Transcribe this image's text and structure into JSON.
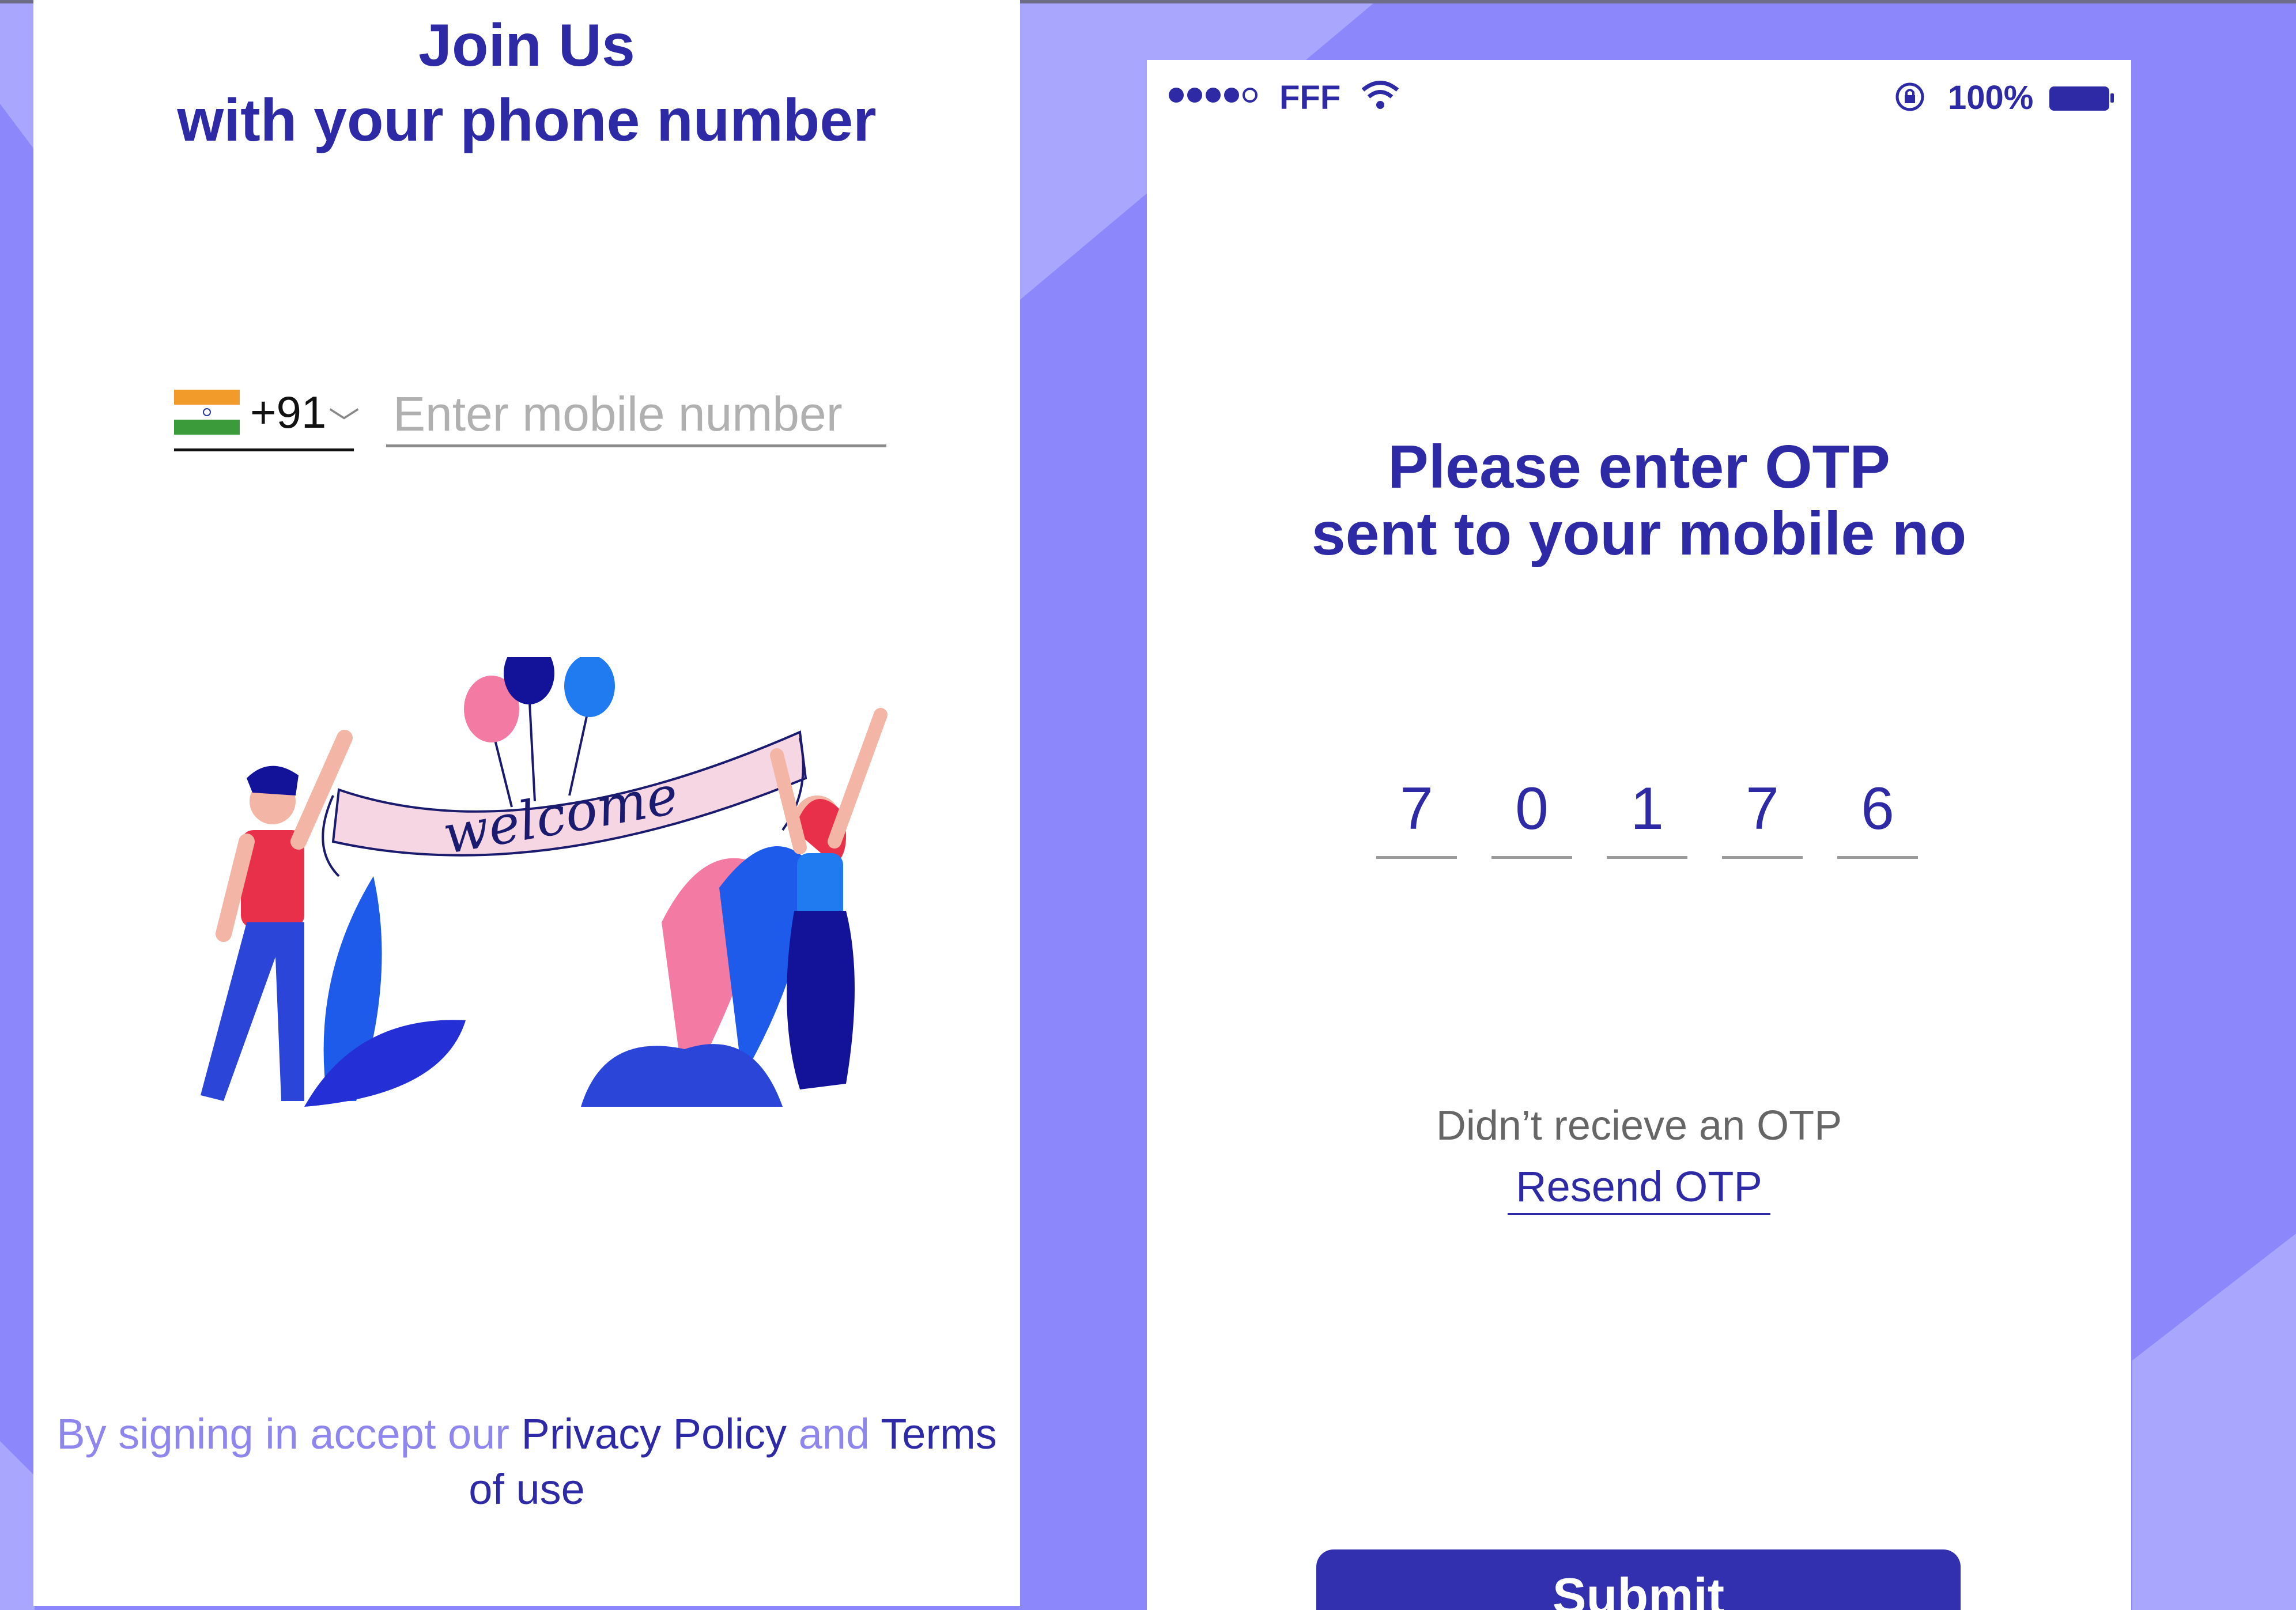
{
  "left_screen": {
    "title_line1": "Join Us",
    "title_line2": "with your phone number",
    "country_code": "+91",
    "phone_placeholder": "Enter mobile number",
    "illustration_text": "welcome",
    "terms_prefix": "By signing in accept our ",
    "privacy_link": "Privacy Policy",
    "terms_and": " and ",
    "terms_link": "Terms of use"
  },
  "right_screen": {
    "status_carrier": "FFF",
    "status_battery": "100%",
    "title_line1": "Please enter OTP",
    "title_line2": "sent to your mobile no",
    "otp_digits": [
      "7",
      "0",
      "1",
      "7",
      "6"
    ],
    "resend_question": "Didn’t recieve an OTP",
    "resend_link": "Resend OTP",
    "submit_label": "Submit"
  },
  "colors": {
    "background": "#8c88fb",
    "accent": "#2e2aa6",
    "button": "#3330b0"
  },
  "icons": [
    "india-flag-icon",
    "chevron-down-icon",
    "signal-dots-icon",
    "wifi-icon",
    "lock-rotation-icon",
    "battery-icon"
  ]
}
